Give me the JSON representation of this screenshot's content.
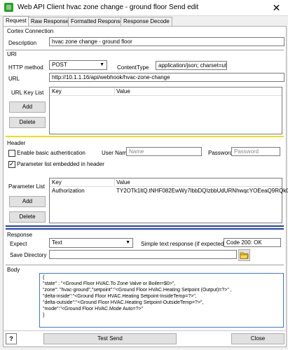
{
  "window": {
    "title": "Web API Client hvac zone change - ground floor Send edit",
    "close_glyph": "✕"
  },
  "tabs": [
    {
      "label": "Request"
    },
    {
      "label": "Raw Response"
    },
    {
      "label": "Formatted Response"
    },
    {
      "label": "Response Decode"
    }
  ],
  "cortex": {
    "section": "Cortex Connection",
    "description_label": "Description",
    "description_value": "hvac zone change - ground floor"
  },
  "uri": {
    "section": "URI",
    "method_label": "HTTP method",
    "method_value": "POST",
    "content_type_label": "ContentType",
    "content_type_value": "application/json; charset=utf-8",
    "url_label": "URL",
    "url_value": "http://10.1.1.16/api/webhook/hvac-zone-change",
    "key_list_label": "URL Key List",
    "col_key": "Key",
    "col_value": "Value",
    "add_label": "Add",
    "delete_label": "Delete"
  },
  "header": {
    "section": "Header",
    "basic_auth_label": "Enable basic authentication",
    "username_label": "User Name",
    "username_placeholder": "Name",
    "password_label": "Password",
    "password_placeholder": "Password",
    "param_embedded_label": "Parameter list embedded in header",
    "param_list_label": "Parameter List",
    "col_key": "Key",
    "col_value": "Value",
    "row_key": "Authorization",
    "row_value": "TY2OTk1ltQ.tNHF082EwWy7lbbDQIzbbUdURNhwqcYOEeaQ9RQk0jM\"",
    "add_label": "Add",
    "delete_label": "Delete"
  },
  "response": {
    "section": "Response",
    "expect_label": "Expect",
    "expect_value": "Text",
    "simple_label": "Simple text response (if expected)",
    "simple_value": "Code 200: OK",
    "save_dir_label": "Save Directory"
  },
  "body": {
    "section": "Body",
    "lines": [
      "{",
      "\"state\" : \"<Ground Floor HVAC.To Zone Valve or Boiler=$0>\",",
      "\"zone\": \"hvac-ground\",\"setpoint\":\"<Ground Floor HVAC.Heating Setpoint (Output)=?>\" ,",
      "\"delta-inside\":\"<Ground Floor HVAC.Heating Setpoint-InsideTemp=?>\",",
      "\"delta-outside\":\"<Ground Floor HVAC.Heating Setpoint-OutsideTemp=?>\",",
      "\"mode\":\"<Ground Floor HVAC.Mode Auto=?>\"",
      "}"
    ]
  },
  "footer": {
    "help_glyph": "?",
    "test_send_label": "Test Send",
    "close_label": "Close"
  }
}
